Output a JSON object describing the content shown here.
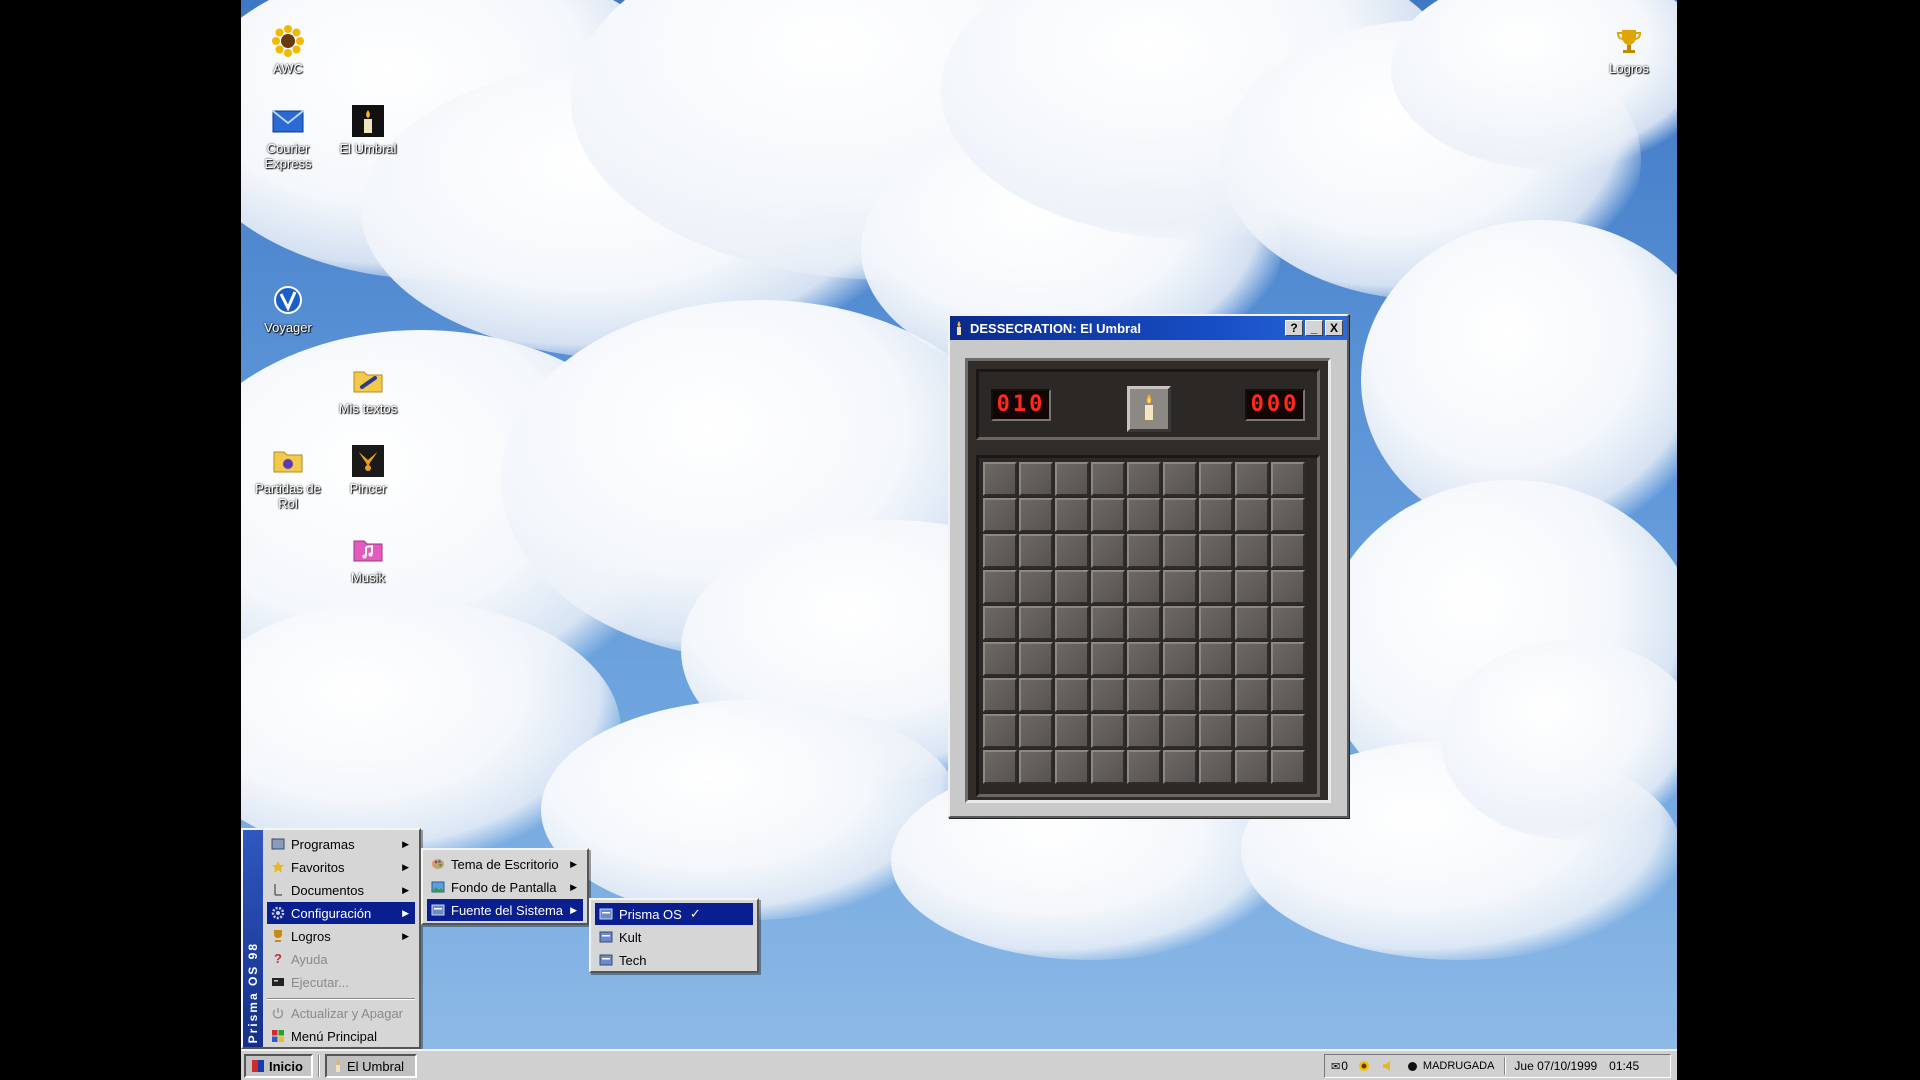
{
  "desktop": {
    "icons": [
      {
        "label": "AWC",
        "icon": "sunflower-icon"
      },
      {
        "label": "Courier Express",
        "icon": "envelope-icon"
      },
      {
        "label": "El Umbral",
        "icon": "candle-icon"
      },
      {
        "label": "Voyager",
        "icon": "globe-icon"
      },
      {
        "label": "Mis textos",
        "icon": "folder-icon"
      },
      {
        "label": "Partidas de Rol",
        "icon": "folder-icon"
      },
      {
        "label": "Pincer",
        "icon": "pincer-icon"
      },
      {
        "label": "Musik",
        "icon": "music-folder-icon"
      },
      {
        "label": "Logros",
        "icon": "trophy-icon"
      }
    ]
  },
  "window": {
    "title": "DESSECRATION: El Umbral",
    "buttons": {
      "help": "?",
      "minimize": "_",
      "close": "X"
    },
    "game": {
      "left_counter": "010",
      "right_counter": "000",
      "center_icon": "candle-icon",
      "grid": {
        "columns": 9,
        "rows": 9
      }
    }
  },
  "start_menu": {
    "side_label": "Prisma OS 98",
    "items": [
      {
        "label": "Programas",
        "has_submenu": true,
        "disabled": false
      },
      {
        "label": "Favoritos",
        "has_submenu": true,
        "disabled": false
      },
      {
        "label": "Documentos",
        "has_submenu": true,
        "disabled": false
      },
      {
        "label": "Configuración",
        "has_submenu": true,
        "disabled": false,
        "selected": true
      },
      {
        "label": "Logros",
        "has_submenu": true,
        "disabled": false
      },
      {
        "label": "Ayuda",
        "has_submenu": false,
        "disabled": true
      },
      {
        "label": "Ejecutar...",
        "has_submenu": false,
        "disabled": true
      },
      {
        "label": "Actualizar y Apagar",
        "has_submenu": false,
        "disabled": true
      },
      {
        "label": "Menú Principal",
        "has_submenu": false,
        "disabled": false
      }
    ]
  },
  "config_submenu": {
    "items": [
      {
        "label": "Tema de Escritorio",
        "has_submenu": true
      },
      {
        "label": "Fondo de Pantalla",
        "has_submenu": true
      },
      {
        "label": "Fuente del Sistema",
        "has_submenu": true,
        "selected": true
      }
    ]
  },
  "font_submenu": {
    "items": [
      {
        "label": "Prisma OS",
        "check": "✓",
        "selected": true
      },
      {
        "label": "Kult",
        "check": ""
      },
      {
        "label": "Tech",
        "check": ""
      }
    ]
  },
  "taskbar": {
    "start_label": "Inicio",
    "task_label": "El Umbral",
    "tray": {
      "mail_count": "0",
      "period": "MADRUGADA",
      "date": "Jue 07/10/1999",
      "time": "01:45"
    }
  },
  "colors": {
    "title_bar": "#0a2a8a",
    "selection": "#0a1f8f",
    "lcd_text": "#ff2a1a",
    "start_side": "#1b3f9e"
  }
}
